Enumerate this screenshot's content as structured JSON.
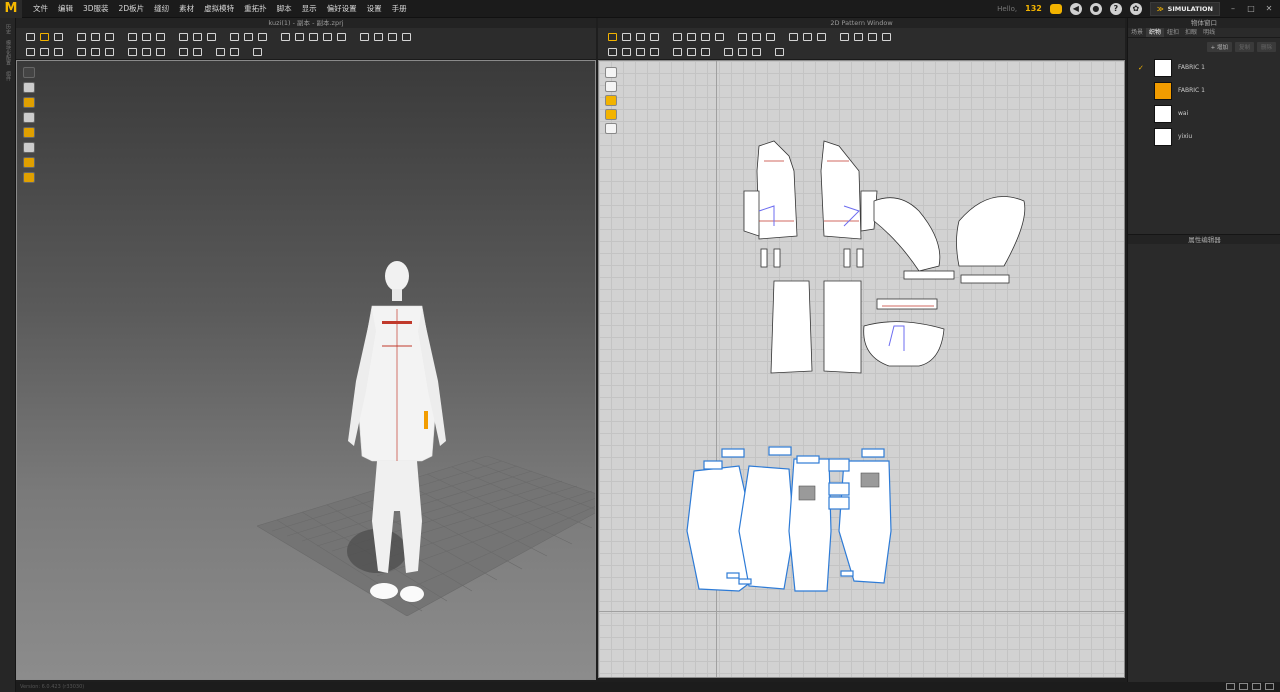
{
  "menu": {
    "logo": "M",
    "items": [
      "文件",
      "编辑",
      "3D服装",
      "2D板片",
      "缝纫",
      "素材",
      "虚拟模特",
      "重拓扑",
      "脚本",
      "显示",
      "偏好设置",
      "设置",
      "手册"
    ]
  },
  "topbar": {
    "hint": "Hello,",
    "counter": "132",
    "mode_label": "SIMULATION",
    "colors": {
      "accent": "#f2b300"
    }
  },
  "left_strip": {
    "labels": [
      "历史",
      "模块化配置",
      "组件"
    ]
  },
  "viewport3d": {
    "title": "kuzi(1) - 副本 - 副本.zprj"
  },
  "viewport2d": {
    "title": "2D Pattern Window"
  },
  "right_panel": {
    "title": "物体窗口",
    "tabs": [
      "场景",
      "织物",
      "纽扣",
      "扣眼",
      "明线"
    ],
    "active_tab": "织物",
    "actions": {
      "add": "+ 增加",
      "copy": "复制",
      "delete": "删除"
    },
    "fabrics": [
      {
        "name": "FABRIC 1",
        "color": "#ffffff",
        "selected": true
      },
      {
        "name": "FABRIC 1",
        "color": "#f29c00",
        "selected": false
      },
      {
        "name": "wai",
        "color": "#ffffff",
        "selected": false
      },
      {
        "name": "yixiu",
        "color": "#ffffff",
        "selected": false
      }
    ],
    "property_editor": "属性编辑器"
  },
  "status": {
    "version": "Version: 6.0.423 (r33030)"
  }
}
